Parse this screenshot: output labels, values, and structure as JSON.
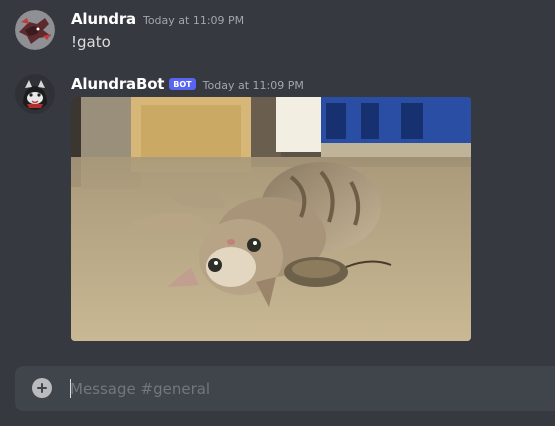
{
  "messages": [
    {
      "username": "Alundra",
      "timestamp": "Today at 11:09 PM",
      "content": "!gato"
    },
    {
      "username": "AlundraBot",
      "bot_tag": "BOT",
      "timestamp": "Today at 11:09 PM"
    }
  ],
  "composer": {
    "placeholder": "Message #general"
  },
  "icons": {
    "add": "plus-circle-icon"
  },
  "colors": {
    "background": "#36393f",
    "input_background": "#40444b",
    "bot_tag": "#5865f2",
    "username": "#ffffff",
    "timestamp": "#a3a6aa",
    "message_text": "#dcddde"
  }
}
